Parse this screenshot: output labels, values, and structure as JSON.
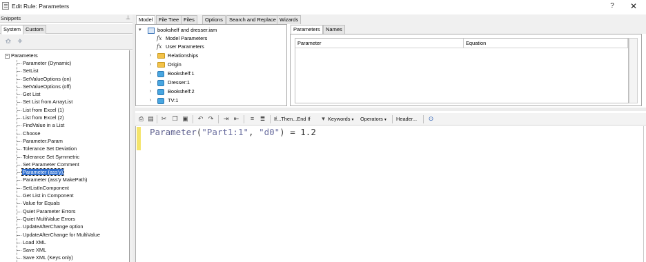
{
  "window": {
    "title": "Edit Rule: Parameters",
    "help_label": "?",
    "close_label": "✕"
  },
  "snippets": {
    "header": "Snippets",
    "pin": "⊥",
    "tabs": [
      {
        "label": "System"
      },
      {
        "label": "Custom"
      }
    ],
    "tree": {
      "root_toggle": "−",
      "root_label": "Parameters",
      "items": [
        "Parameter (Dynamic)",
        "SetList",
        "SetValueOptions (on)",
        "SetValueOptions (off)",
        "Get List",
        "Set List from ArrayList",
        "List from Excel (1)",
        "List from Excel (2)",
        "FindValue in a List",
        "Choose",
        "Parameter.Param",
        "Tolerance Set Deviation",
        "Tolerance Set Symmetric",
        "Set Parameter Comment",
        "Parameter (ass'y)",
        "Parameter (ass'y MakePath)",
        "SetListInComponent",
        "Get List in Component",
        "Value for Equals",
        "Quiet Parameter Errors",
        "Quiet MultiValue Errors",
        "UpdateAfterChange option",
        "UpdateAfterChange for MultiValue",
        "Load XML",
        "Save XML",
        "Save XML (Keys only)"
      ],
      "selected_index": 14
    }
  },
  "main_tabs": [
    {
      "label": "Model"
    },
    {
      "label": "File Tree"
    },
    {
      "label": "Files"
    },
    {
      "label": "Options"
    },
    {
      "label": "Search and Replace"
    },
    {
      "label": "Wizards"
    }
  ],
  "model_tree": {
    "root": "bookshelf and dresser.iam",
    "fx_items": [
      "Model Parameters",
      "User Parameters"
    ],
    "folders": [
      "Relationships",
      "Origin"
    ],
    "parts": [
      "Bookshelf:1",
      "Dresser:1",
      "Bookshelf:2",
      "TV:1"
    ]
  },
  "params_tabs": [
    {
      "label": "Parameters"
    },
    {
      "label": "Names"
    }
  ],
  "params_grid": {
    "columns": [
      "Parameter",
      "Equation"
    ]
  },
  "editor_toolbar": {
    "if_then": "If...Then...End If",
    "keywords": "Keywords",
    "operators": "Operators",
    "header": "Header..."
  },
  "editor": {
    "fn": "Parameter",
    "open": "(",
    "arg1": "\"Part1:1\"",
    "comma": ", ",
    "arg2": "\"d0\"",
    "close": ")",
    "op": " = ",
    "value": "1.2"
  }
}
